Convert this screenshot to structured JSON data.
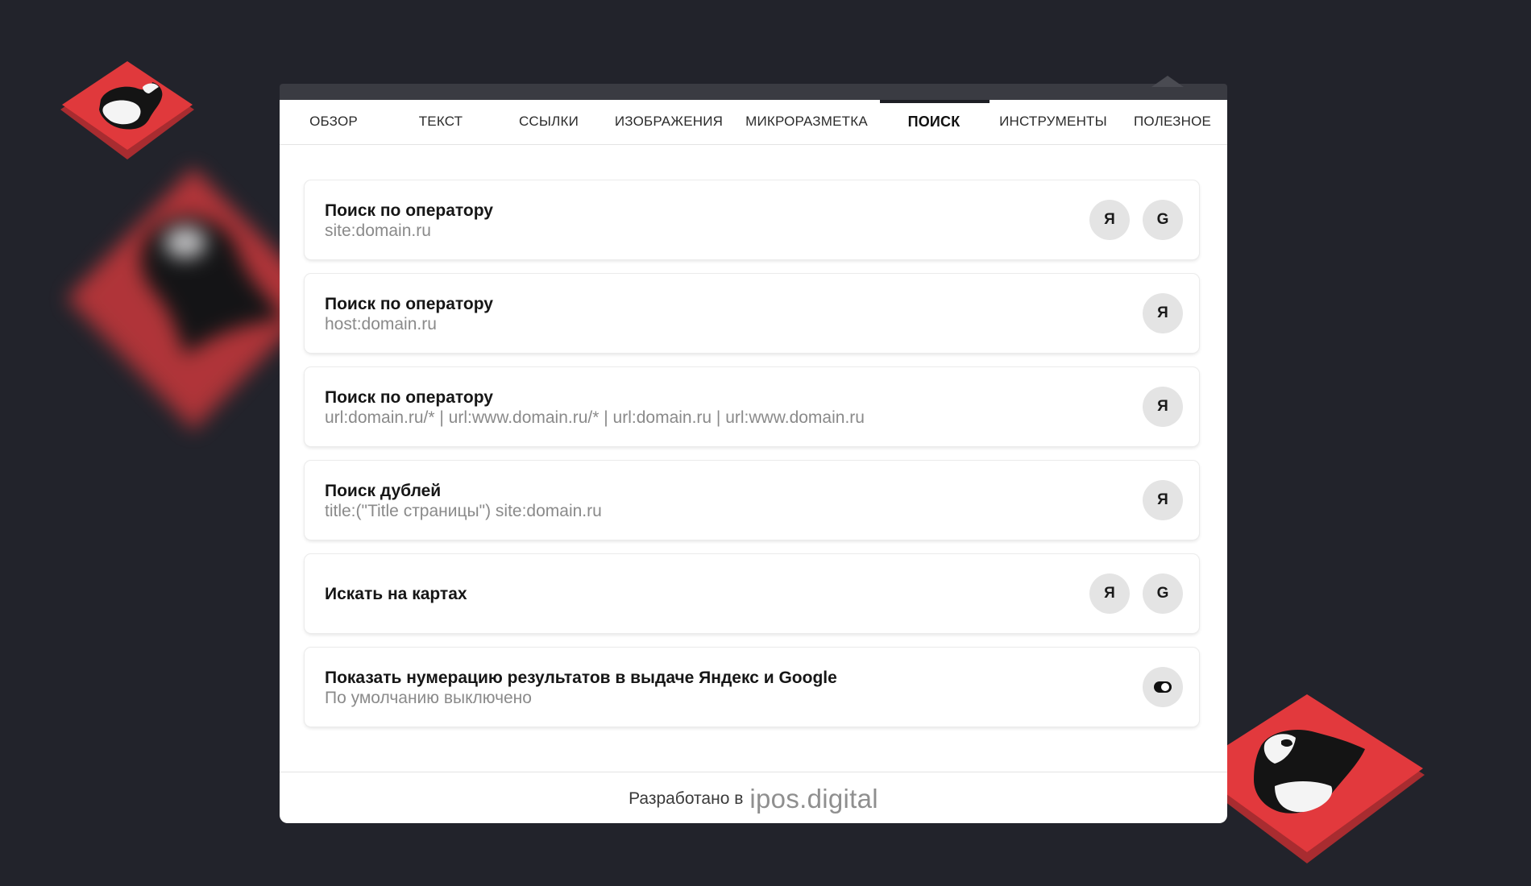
{
  "tabs": [
    {
      "label": "ОБЗОР",
      "active": false
    },
    {
      "label": "ТЕКСТ",
      "active": false
    },
    {
      "label": "ССЫЛКИ",
      "active": false
    },
    {
      "label": "ИЗОБРАЖЕНИЯ",
      "active": false
    },
    {
      "label": "МИКРОРАЗМЕТКА",
      "active": false
    },
    {
      "label": "ПОИСК",
      "active": true
    },
    {
      "label": "ИНСТРУМЕНТЫ",
      "active": false
    },
    {
      "label": "ПОЛЕЗНОЕ",
      "active": false
    }
  ],
  "cards": [
    {
      "title": "Поиск по оператору",
      "subtitle": "site:domain.ru",
      "buttons": [
        "Я",
        "G"
      ]
    },
    {
      "title": "Поиск по оператору",
      "subtitle": "host:domain.ru",
      "buttons": [
        "Я"
      ]
    },
    {
      "title": "Поиск по оператору",
      "subtitle": "url:domain.ru/* | url:www.domain.ru/* | url:domain.ru | url:www.domain.ru",
      "buttons": [
        "Я"
      ]
    },
    {
      "title": "Поиск дублей",
      "subtitle": "title:(\"Title страницы\") site:domain.ru",
      "buttons": [
        "Я"
      ]
    },
    {
      "title": "Искать на картах",
      "buttons": [
        "Я",
        "G"
      ]
    },
    {
      "title": "Показать нумерацию результатов в выдаче Яндекс и Google",
      "subtitle": "По умолчанию выключено",
      "toggle": "off"
    }
  ],
  "footer": {
    "text": "Разработано в",
    "brand": "ipos.digital"
  },
  "colors": {
    "background": "#22232b",
    "logo_red": "#d83a3d",
    "panel": "#ffffff",
    "button_bg": "#e4e4e4"
  },
  "icons": {
    "logo": "bell-logo-icon",
    "toggle": "toggle-switch-icon"
  }
}
